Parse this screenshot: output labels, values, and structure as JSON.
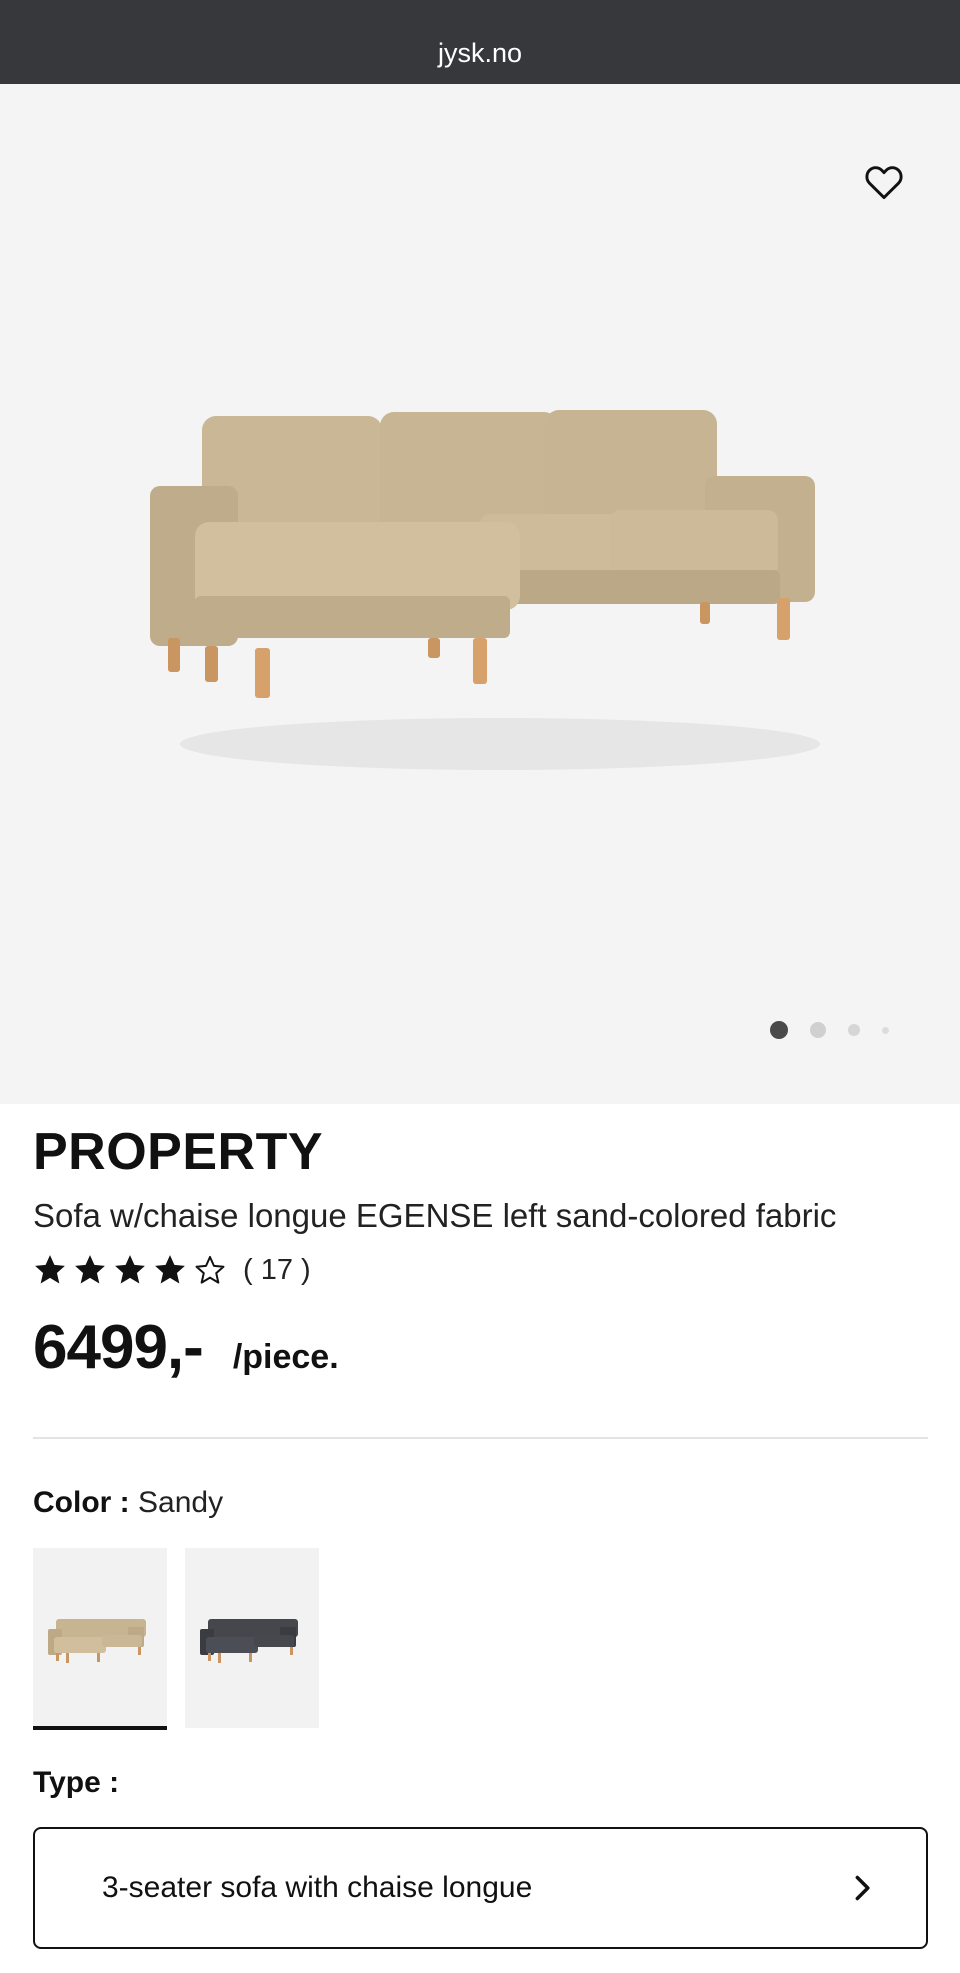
{
  "browser": {
    "url": "jysk.no"
  },
  "product": {
    "brand": "PROPERTY",
    "title": "Sofa w/chaise longue EGENSE left sand-colored fabric",
    "rating": {
      "stars": 4,
      "max": 5,
      "count_text": "( 17 )"
    },
    "price": "6499,-",
    "unit": "/piece."
  },
  "gallery": {
    "slides": 4,
    "active_slide": 1
  },
  "color": {
    "label": "Color :",
    "value": "Sandy",
    "options": [
      {
        "name": "Sandy",
        "swatch": "#c8b592",
        "selected": true
      },
      {
        "name": "Dark grey",
        "swatch": "#3d3f45",
        "selected": false
      }
    ]
  },
  "type": {
    "label": "Type :",
    "value": "3-seater sofa with chaise longue"
  },
  "icons": {
    "wishlist": "heart-outline-icon",
    "chevron": "chevron-right-icon",
    "star_filled": "star-filled-icon",
    "star_empty": "star-outline-icon"
  }
}
